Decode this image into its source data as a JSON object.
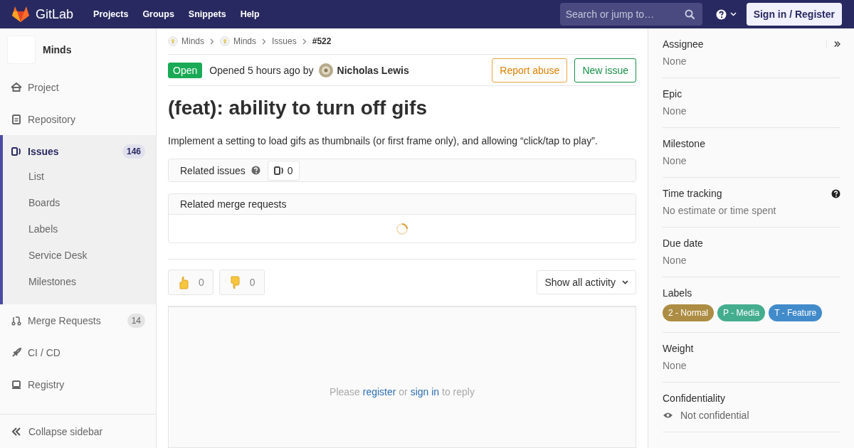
{
  "navbar": {
    "brand": "GitLab",
    "links": [
      "Projects",
      "Groups",
      "Snippets",
      "Help"
    ],
    "search": {
      "placeholder": "Search or jump to…"
    },
    "sign_in": "Sign in / Register"
  },
  "sidebar": {
    "project": "Minds",
    "items": [
      {
        "label": "Project",
        "kind": "project",
        "selected": false
      },
      {
        "label": "Repository",
        "kind": "repository",
        "selected": false
      },
      {
        "label": "Issues",
        "kind": "issues",
        "selected": true,
        "count": "146",
        "children": [
          "List",
          "Boards",
          "Labels",
          "Service Desk",
          "Milestones"
        ]
      },
      {
        "label": "Merge Requests",
        "kind": "merge",
        "selected": false,
        "count": "14"
      },
      {
        "label": "CI / CD",
        "kind": "rocket",
        "selected": false
      },
      {
        "label": "Registry",
        "kind": "registry",
        "selected": false
      }
    ],
    "collapse": "Collapse sidebar"
  },
  "breadcrumb": [
    {
      "label": "Minds",
      "avatar": true
    },
    {
      "label": "Minds",
      "avatar": true
    },
    {
      "label": "Issues",
      "avatar": false
    },
    {
      "label": "#522",
      "avatar": false
    }
  ],
  "issue": {
    "status": "Open",
    "opened": "Opened 5 hours ago by",
    "author": "Nicholas Lewis",
    "buttons": [
      {
        "label": "Report abuse",
        "kind": "warning"
      },
      {
        "label": "New issue",
        "kind": "success"
      }
    ],
    "title": "(feat): ability to turn off gifs",
    "description": "Implement a setting to load gifs as thumbnails (or first frame only), and allowing “click/tap to play”."
  },
  "related_issues": {
    "title": "Related issues",
    "count": "0"
  },
  "related_merge_requests": {
    "title": "Related merge requests"
  },
  "awards": [
    {
      "kind": "thumbsup",
      "count": "0"
    },
    {
      "kind": "thumbsdown",
      "count": "0"
    }
  ],
  "activity_filter": "Show all activity",
  "reply": {
    "before": "Please",
    "register": "register",
    "middle": "or",
    "sign_in": "sign in",
    "after": "to reply"
  },
  "right_sidebar": [
    {
      "title": "Assignee",
      "value": "None",
      "kind": "toggle"
    },
    {
      "title": "Epic",
      "value": "None",
      "kind": "text"
    },
    {
      "title": "Milestone",
      "value": "None",
      "kind": "text"
    },
    {
      "title": "Time tracking",
      "value": "No estimate or time spent",
      "kind": "help"
    },
    {
      "title": "Due date",
      "value": "None",
      "kind": "text"
    },
    {
      "title": "Labels",
      "kind": "labels",
      "labels": [
        {
          "text": "2 - Normal",
          "color": "#ad8d43"
        },
        {
          "text": "P - Media",
          "color": "#44ad8e"
        },
        {
          "text": "T - Feature",
          "color": "#428bca"
        }
      ]
    },
    {
      "title": "Weight",
      "value": "None",
      "kind": "text"
    },
    {
      "title": "Confidentiality",
      "value": "Not confidential",
      "kind": "confidential"
    }
  ]
}
